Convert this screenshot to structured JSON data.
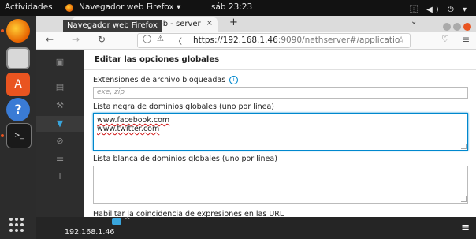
{
  "topbar": {
    "activities": "Actividades",
    "app_name": "Navegador web Firefox ▾",
    "clock": "sáb 23:23",
    "tray": "⿰ ◀) ⏻ ▾"
  },
  "browser": {
    "tab_title": "Configuración - web - server",
    "tab_close": "×",
    "tooltip": "Navegador web Firefox",
    "new_tab": "+",
    "tabs_menu": "⌄",
    "url_host": "https://192.168.1.46",
    "url_rest": ":9090/nethserver#/applicatio",
    "nav_back": "←",
    "nav_forward": "→",
    "nav_reload": "↻"
  },
  "colors": {
    "accent": "#0088ce",
    "ubuntu_orange": "#e95420",
    "sidebar": "#2d2d2d"
  },
  "page": {
    "header": "Editar las opciones globales",
    "ext_label": "Extensiones de archivo bloqueadas",
    "ext_info": "i",
    "ext_placeholder": "exe, zip",
    "blacklist_label": "Lista negra de dominios globales (uno por línea)",
    "blacklist_lines": [
      "www.facebook.com",
      "www.twitter.com"
    ],
    "whitelist_label": "Lista blanca de dominios globales (uno por línea)",
    "regex_label": "Habilitar la coincidencia de expresiones en las URL"
  },
  "status": {
    "ip": "192.168.1.46",
    "arrow": "^",
    "menu": "≡"
  }
}
